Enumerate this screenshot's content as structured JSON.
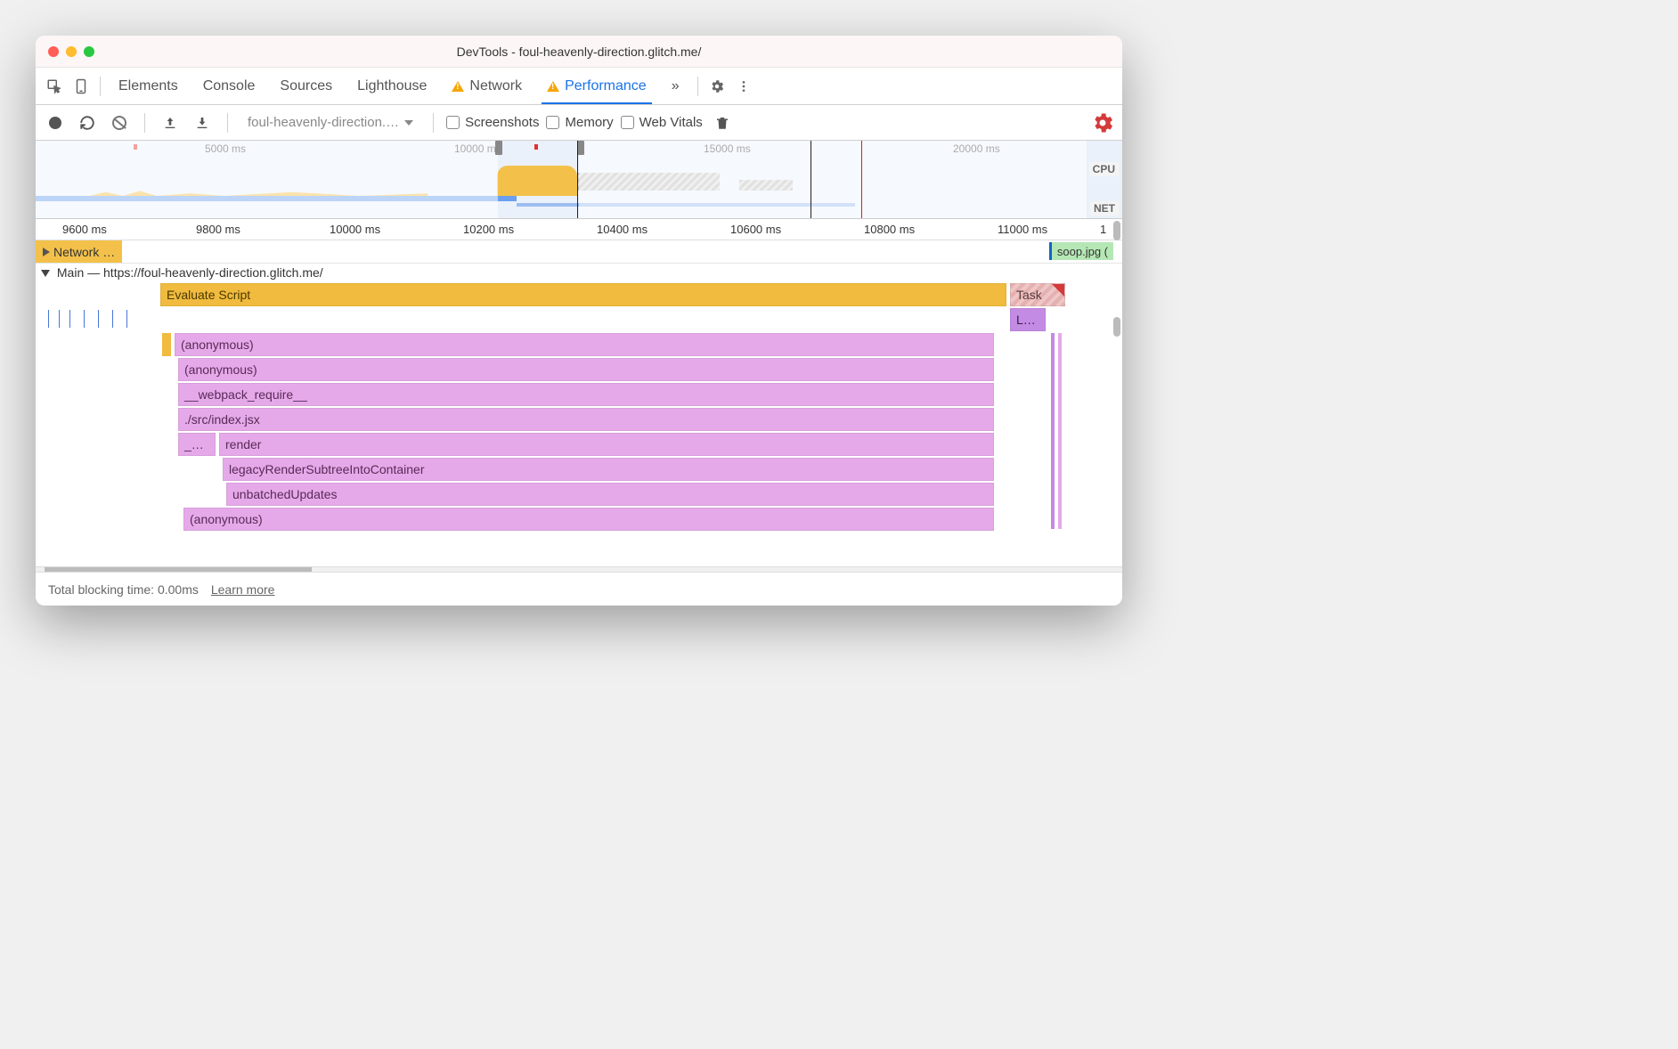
{
  "window": {
    "title": "DevTools - foul-heavenly-direction.glitch.me/"
  },
  "tabs": {
    "elements": "Elements",
    "console": "Console",
    "sources": "Sources",
    "lighthouse": "Lighthouse",
    "network": "Network",
    "performance": "Performance",
    "more": "»"
  },
  "toolbar": {
    "dropdown_label": "foul-heavenly-direction.…",
    "screenshots": "Screenshots",
    "memory": "Memory",
    "webvitals": "Web Vitals"
  },
  "overview": {
    "ticks": [
      "5000 ms",
      "10000 ms",
      "15000 ms",
      "20000 ms"
    ],
    "cpu_label": "CPU",
    "net_label": "NET"
  },
  "ruler": {
    "ticks": [
      "9600 ms",
      "9800 ms",
      "10000 ms",
      "10200 ms",
      "10400 ms",
      "10600 ms",
      "10800 ms",
      "11000 ms",
      "1"
    ]
  },
  "network_row": {
    "label": "Network …",
    "file": "soop.jpg ("
  },
  "main": {
    "header_prefix": "Main — ",
    "url": "https://foul-heavenly-direction.glitch.me/",
    "task": "Task",
    "task2": "Task",
    "evaluate": "Evaluate Script",
    "l": "L…",
    "anon": "(anonymous)",
    "webpack": "__webpack_require__",
    "src": "./src/index.jsx",
    "underscore": "_…",
    "render": "render",
    "legacy": "legacyRenderSubtreeIntoContainer",
    "unbatched": "unbatchedUpdates"
  },
  "footer": {
    "tbt": "Total blocking time: 0.00ms",
    "learn": "Learn more"
  }
}
